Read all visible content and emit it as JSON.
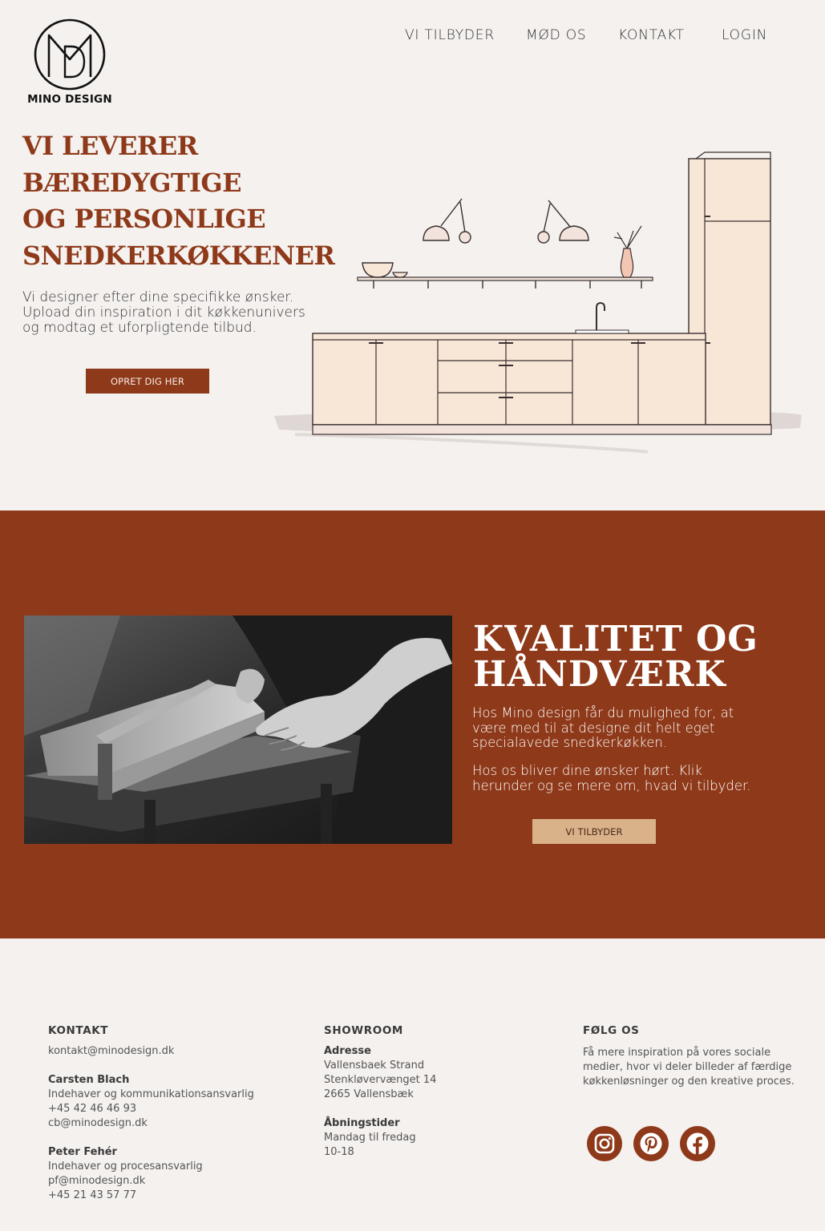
{
  "brand": {
    "name": "MINO DESIGN",
    "accent": "#8e3919",
    "button_light": "#d9b28a",
    "background": "#f4f1ef"
  },
  "nav": [
    {
      "label": "VI TILBYDER"
    },
    {
      "label": "MØD OS"
    },
    {
      "label": "KONTAKT"
    },
    {
      "label": "LOGIN"
    }
  ],
  "hero": {
    "title_lines": [
      "VI LEVERER",
      "BÆREDYGTIGE",
      "OG PERSONLIGE",
      "SNEDKERKØKKENER"
    ],
    "text_lines": [
      "Vi designer efter dine specifikke ønsker.",
      "Upload din inspiration i dit køkkenunivers",
      "og modtag et uforpligtende tilbud."
    ],
    "button_label": "OPRET DIG HER"
  },
  "quality": {
    "title_lines": [
      "KVALITET OG",
      "HÅNDVÆRK"
    ],
    "paragraph1_lines": [
      "Hos Mino design får du mulighed for, at",
      "være med til at designe dit helt eget",
      "specialavede snedkerkøkken."
    ],
    "paragraph2_lines": [
      "Hos os bliver dine ønsker hørt. Klik",
      "herunder og se mere om, hvad vi tilbyder."
    ],
    "button_label": "VI TILBYDER"
  },
  "footer": {
    "kontakt": {
      "heading": "KONTAKT",
      "email": "kontakt@minodesign.dk",
      "person1": {
        "name": "Carsten Blach",
        "role": "Indehaver og kommunikationsansvarlig",
        "phone": "+45 42 46 46 93",
        "email": "cb@minodesign.dk"
      },
      "person2": {
        "name": "Peter Fehér",
        "role": "Indehaver og procesansvarlig",
        "email": "pf@minodesign.dk",
        "phone": "+45 21 43 57 77"
      }
    },
    "showroom": {
      "heading": "SHOWROOM",
      "address_label": "Adresse",
      "address_lines": [
        "Vallensbaek Strand",
        "Stenkløvervænget 14",
        "2665 Vallensbæk"
      ],
      "hours_label": "Åbningstider",
      "hours_lines": [
        "Mandag til fredag",
        "10-18"
      ]
    },
    "follow": {
      "heading": "FØLG OS",
      "text_lines": [
        "Få mere inspiration på vores sociale",
        "medier, hvor vi deler billeder af færdige",
        "køkkenløsninger og den kreative proces."
      ],
      "icons": [
        "instagram-icon",
        "pinterest-icon",
        "facebook-icon"
      ]
    }
  }
}
